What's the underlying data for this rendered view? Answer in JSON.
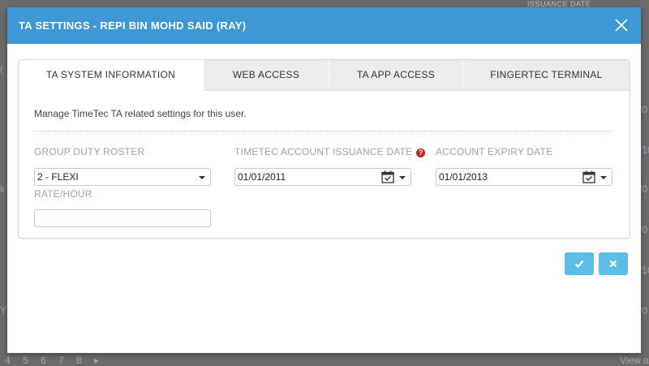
{
  "background": {
    "header_text": "ISSUANCE DATE",
    "right_fragments": [
      "/0",
      "/10",
      "/0",
      "/0",
      "/10",
      "/0"
    ],
    "left_fragments": [
      "(",
      "k",
      "Y"
    ],
    "pager": [
      "4",
      "5",
      "6",
      "7",
      "8"
    ],
    "pager_next": "▸",
    "view_text": "View a"
  },
  "modal": {
    "title": "TA SETTINGS - REPI BIN MOHD SAID (RAY)",
    "close_icon": "close-icon",
    "header_color": "#3e98d6"
  },
  "tabs": [
    {
      "label": "TA SYSTEM INFORMATION",
      "active": true
    },
    {
      "label": "WEB ACCESS",
      "active": false
    },
    {
      "label": "TA APP ACCESS",
      "active": false
    },
    {
      "label": "FINGERTEC TERMINAL",
      "active": false
    }
  ],
  "form": {
    "description": "Manage TimeTec TA related settings for this user.",
    "group_duty_roster": {
      "label": "GROUP DUTY ROSTER",
      "value": "2 - FLEXI"
    },
    "issuance_date": {
      "label": "TIMETEC ACCOUNT ISSUANCE DATE",
      "value": "01/01/2011",
      "help": "?"
    },
    "expiry_date": {
      "label": "ACCOUNT EXPIRY DATE",
      "value": "01/01/2013"
    },
    "rate_hour": {
      "label": "RATE/HOUR",
      "value": ""
    }
  },
  "buttons": {
    "confirm_icon": "check-icon",
    "cancel_icon": "x-icon",
    "color": "#5cbde6"
  }
}
